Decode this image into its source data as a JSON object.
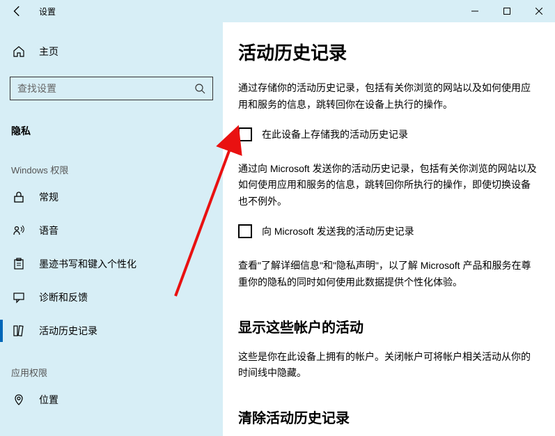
{
  "titlebar": {
    "title": "设置"
  },
  "sidebar": {
    "home_label": "主页",
    "search_placeholder": "查找设置",
    "category_heading": "隐私",
    "subcategory_heading": "Windows 权限",
    "items": [
      {
        "label": "常规"
      },
      {
        "label": "语音"
      },
      {
        "label": "墨迹书写和键入个性化"
      },
      {
        "label": "诊断和反馈"
      },
      {
        "label": "活动历史记录"
      }
    ],
    "app_perm_heading": "应用权限",
    "app_perm_items": [
      {
        "label": "位置"
      }
    ]
  },
  "main": {
    "page_title": "活动历史记录",
    "para1": "通过存储你的活动历史记录，包括有关你浏览的网站以及如何使用应用和服务的信息，跳转回你在设备上执行的操作。",
    "checkbox1_label": "在此设备上存储我的活动历史记录",
    "para2": "通过向 Microsoft 发送你的活动历史记录，包括有关你浏览的网站以及如何使用应用和服务的信息，跳转回你所执行的操作，即使切换设备也不例外。",
    "checkbox2_label": "向 Microsoft 发送我的活动历史记录",
    "para3": "查看\"了解详细信息\"和\"隐私声明\"，以了解 Microsoft 产品和服务在尊重你的隐私的同时如何使用此数据提供个性化体验。",
    "section2_title": "显示这些帐户的活动",
    "para4": "这些是你在此设备上拥有的帐户。关闭帐户可将帐户相关活动从你的时间线中隐藏。",
    "section3_title": "清除活动历史记录"
  }
}
